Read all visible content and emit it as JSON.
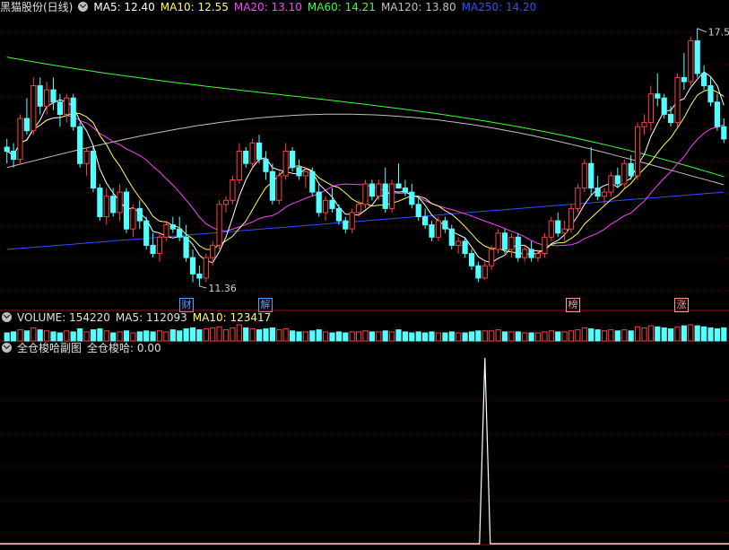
{
  "main_header": {
    "stock": "黑猫股份(日线)",
    "ma5": "MA5: 12.40",
    "ma10": "MA10: 12.55",
    "ma20": "MA20: 13.10",
    "ma60": "MA60: 14.21",
    "ma120": "MA120: 13.80",
    "ma250": "MA250: 14.20"
  },
  "volume_header": {
    "volume": "VOLUME: 154220",
    "ma5": "MA5: 112093",
    "ma10": "MA10: 123417"
  },
  "sub_header": {
    "title": "全仓梭哈副图",
    "value": "全仓梭哈: 0.00"
  },
  "annotations": {
    "high_label": "17.5",
    "low_label": "11.36"
  },
  "event_tags": [
    {
      "text": "财",
      "color": "#5aa0ff"
    },
    {
      "text": "解",
      "color": "#5aa0ff"
    },
    {
      "text": "榜",
      "color": "#ff9a9a"
    },
    {
      "text": "涨",
      "color": "#ff9a9a"
    }
  ],
  "colors": {
    "up": "#ff4040",
    "down": "#54ffff",
    "ma5": "#ffffff",
    "ma10": "#ffff60",
    "ma20": "#ff40ff",
    "ma60": "#40ff40",
    "ma120": "#c0c0c0",
    "ma250": "#3050ff",
    "grid": "#7a0000"
  },
  "chart_data": {
    "type": "candlestick",
    "ylim": [
      10.96,
      17.8
    ],
    "candles": [
      [
        14.6,
        14.8,
        14.2,
        14.5
      ],
      [
        14.5,
        14.7,
        14.1,
        14.3
      ],
      [
        14.3,
        15.4,
        14.2,
        15.3
      ],
      [
        15.3,
        15.8,
        14.9,
        15.0
      ],
      [
        15.0,
        16.3,
        14.9,
        16.1
      ],
      [
        16.1,
        16.3,
        15.4,
        15.6
      ],
      [
        15.6,
        16.2,
        15.4,
        16.0
      ],
      [
        16.0,
        16.3,
        15.5,
        15.7
      ],
      [
        15.7,
        15.9,
        15.1,
        15.4
      ],
      [
        15.4,
        15.9,
        15.2,
        15.8
      ],
      [
        15.8,
        15.9,
        15.0,
        15.1
      ],
      [
        15.1,
        15.2,
        14.1,
        14.2
      ],
      [
        14.2,
        14.6,
        13.9,
        14.5
      ],
      [
        14.5,
        14.6,
        13.5,
        13.6
      ],
      [
        13.6,
        13.7,
        12.8,
        12.9
      ],
      [
        12.9,
        13.6,
        12.7,
        13.4
      ],
      [
        13.4,
        13.6,
        12.9,
        13.0
      ],
      [
        13.0,
        13.7,
        12.8,
        13.5
      ],
      [
        13.5,
        13.6,
        12.5,
        12.6
      ],
      [
        12.6,
        13.2,
        12.4,
        13.1
      ],
      [
        13.1,
        13.3,
        12.6,
        12.8
      ],
      [
        12.8,
        12.9,
        12.1,
        12.2
      ],
      [
        12.2,
        12.5,
        11.9,
        12.0
      ],
      [
        12.0,
        12.5,
        11.8,
        12.4
      ],
      [
        12.4,
        12.8,
        12.3,
        12.7
      ],
      [
        12.7,
        12.9,
        12.5,
        12.6
      ],
      [
        12.6,
        12.9,
        12.3,
        12.4
      ],
      [
        12.4,
        12.7,
        11.8,
        11.9
      ],
      [
        11.9,
        12.1,
        11.3,
        11.5
      ],
      [
        11.5,
        11.7,
        11.2,
        11.4
      ],
      [
        11.4,
        12.0,
        11.3,
        11.9
      ],
      [
        11.9,
        12.3,
        11.7,
        12.2
      ],
      [
        12.2,
        13.3,
        12.1,
        13.2
      ],
      [
        13.2,
        13.4,
        13.0,
        13.3
      ],
      [
        13.3,
        13.9,
        13.2,
        13.8
      ],
      [
        13.8,
        14.7,
        13.7,
        14.5
      ],
      [
        14.5,
        14.6,
        14.1,
        14.2
      ],
      [
        14.2,
        14.8,
        14.1,
        14.7
      ],
      [
        14.7,
        14.9,
        14.2,
        14.3
      ],
      [
        14.3,
        14.5,
        13.8,
        14.0
      ],
      [
        14.0,
        14.2,
        13.2,
        13.3
      ],
      [
        13.3,
        14.0,
        13.2,
        13.9
      ],
      [
        13.9,
        14.7,
        13.8,
        14.5
      ],
      [
        14.5,
        14.6,
        14.0,
        14.1
      ],
      [
        14.1,
        14.3,
        13.8,
        13.9
      ],
      [
        13.9,
        14.1,
        13.6,
        14.0
      ],
      [
        14.0,
        14.1,
        13.4,
        13.5
      ],
      [
        13.5,
        13.7,
        12.9,
        13.0
      ],
      [
        13.0,
        13.4,
        12.8,
        13.3
      ],
      [
        13.3,
        13.6,
        13.0,
        13.1
      ],
      [
        13.1,
        13.2,
        12.7,
        12.8
      ],
      [
        12.8,
        12.9,
        12.5,
        12.6
      ],
      [
        12.6,
        13.1,
        12.5,
        13.0
      ],
      [
        13.0,
        13.3,
        12.9,
        13.2
      ],
      [
        13.2,
        13.8,
        13.1,
        13.7
      ],
      [
        13.7,
        13.8,
        13.3,
        13.4
      ],
      [
        13.4,
        13.8,
        13.3,
        13.7
      ],
      [
        13.7,
        14.1,
        13.0,
        13.1
      ],
      [
        13.1,
        13.8,
        13.0,
        13.7
      ],
      [
        13.7,
        14.2,
        13.6,
        13.6
      ],
      [
        13.6,
        13.8,
        13.4,
        13.5
      ],
      [
        13.5,
        13.7,
        13.1,
        13.2
      ],
      [
        13.2,
        13.4,
        12.8,
        12.9
      ],
      [
        12.9,
        13.1,
        12.6,
        12.7
      ],
      [
        12.7,
        12.8,
        12.3,
        12.4
      ],
      [
        12.4,
        12.9,
        12.3,
        12.8
      ],
      [
        12.8,
        12.9,
        12.5,
        12.6
      ],
      [
        12.6,
        12.7,
        12.1,
        12.2
      ],
      [
        12.2,
        12.4,
        12.0,
        12.3
      ],
      [
        12.3,
        12.4,
        11.9,
        12.0
      ],
      [
        12.0,
        12.1,
        11.6,
        11.7
      ],
      [
        11.7,
        11.8,
        11.3,
        11.4
      ],
      [
        11.4,
        11.8,
        11.36,
        11.7
      ],
      [
        11.7,
        12.2,
        11.6,
        12.1
      ],
      [
        12.1,
        12.6,
        12.0,
        12.5
      ],
      [
        12.5,
        12.6,
        12.0,
        12.1
      ],
      [
        12.1,
        12.5,
        11.9,
        12.4
      ],
      [
        12.4,
        12.5,
        11.8,
        11.9
      ],
      [
        11.9,
        12.2,
        11.8,
        12.1
      ],
      [
        12.1,
        12.3,
        11.8,
        11.9
      ],
      [
        11.9,
        12.1,
        11.8,
        12.0
      ],
      [
        12.0,
        12.5,
        11.9,
        12.4
      ],
      [
        12.4,
        12.9,
        12.3,
        12.8
      ],
      [
        12.8,
        13.0,
        12.4,
        12.5
      ],
      [
        12.5,
        12.8,
        12.3,
        12.6
      ],
      [
        12.6,
        13.2,
        12.5,
        13.1
      ],
      [
        13.1,
        13.7,
        13.0,
        13.6
      ],
      [
        13.6,
        14.3,
        13.5,
        14.2
      ],
      [
        14.2,
        14.6,
        13.4,
        13.6
      ],
      [
        13.6,
        13.9,
        13.3,
        13.4
      ],
      [
        13.4,
        13.6,
        13.2,
        13.5
      ],
      [
        13.5,
        14.0,
        13.4,
        13.9
      ],
      [
        13.9,
        14.1,
        13.6,
        13.7
      ],
      [
        13.7,
        14.3,
        13.6,
        14.2
      ],
      [
        14.2,
        14.4,
        13.8,
        13.9
      ],
      [
        13.9,
        15.2,
        13.8,
        15.1
      ],
      [
        15.1,
        15.4,
        14.9,
        15.2
      ],
      [
        15.2,
        16.1,
        15.0,
        15.9
      ],
      [
        15.9,
        16.4,
        15.6,
        15.8
      ],
      [
        15.8,
        15.9,
        15.3,
        15.4
      ],
      [
        15.4,
        15.6,
        15.1,
        15.2
      ],
      [
        15.2,
        16.4,
        15.1,
        16.3
      ],
      [
        16.3,
        16.9,
        16.0,
        16.2
      ],
      [
        16.2,
        17.3,
        16.1,
        17.2
      ],
      [
        17.2,
        17.5,
        16.3,
        16.4
      ],
      [
        16.4,
        16.6,
        16.0,
        16.1
      ],
      [
        16.1,
        16.3,
        15.6,
        15.7
      ],
      [
        15.7,
        15.9,
        15.0,
        15.1
      ],
      [
        15.1,
        15.3,
        14.7,
        14.8
      ]
    ],
    "volume": [
      0.8,
      0.9,
      1.1,
      1.0,
      1.3,
      1.1,
      1.0,
      0.9,
      0.8,
      1.0,
      0.9,
      1.2,
      0.9,
      1.1,
      1.2,
      1.0,
      0.8,
      0.9,
      1.0,
      0.8,
      0.9,
      1.0,
      0.9,
      1.0,
      0.9,
      1.1,
      1.0,
      1.2,
      1.3,
      1.1,
      1.2,
      1.3,
      1.4,
      1.1,
      1.3,
      1.6,
      1.3,
      1.2,
      1.1,
      1.2,
      1.3,
      1.1,
      1.2,
      1.0,
      0.9,
      0.9,
      1.0,
      1.1,
      0.9,
      0.8,
      0.9,
      0.8,
      0.9,
      0.9,
      1.0,
      0.9,
      0.9,
      1.0,
      0.9,
      1.1,
      0.9,
      0.8,
      0.9,
      0.8,
      0.9,
      0.8,
      0.8,
      0.9,
      0.8,
      0.8,
      0.9,
      1.0,
      1.0,
      1.0,
      1.1,
      0.9,
      0.9,
      0.9,
      0.8,
      0.8,
      0.8,
      0.9,
      1.0,
      0.9,
      0.9,
      1.0,
      1.1,
      1.3,
      1.2,
      1.1,
      1.0,
      1.1,
      1.0,
      1.1,
      1.0,
      1.4,
      1.3,
      1.5,
      1.4,
      1.3,
      1.2,
      1.4,
      1.5,
      1.6,
      1.5,
      1.4,
      1.3,
      1.2,
      1.3
    ],
    "subchart_peak_index": 72,
    "subchart_value": 0.0
  }
}
